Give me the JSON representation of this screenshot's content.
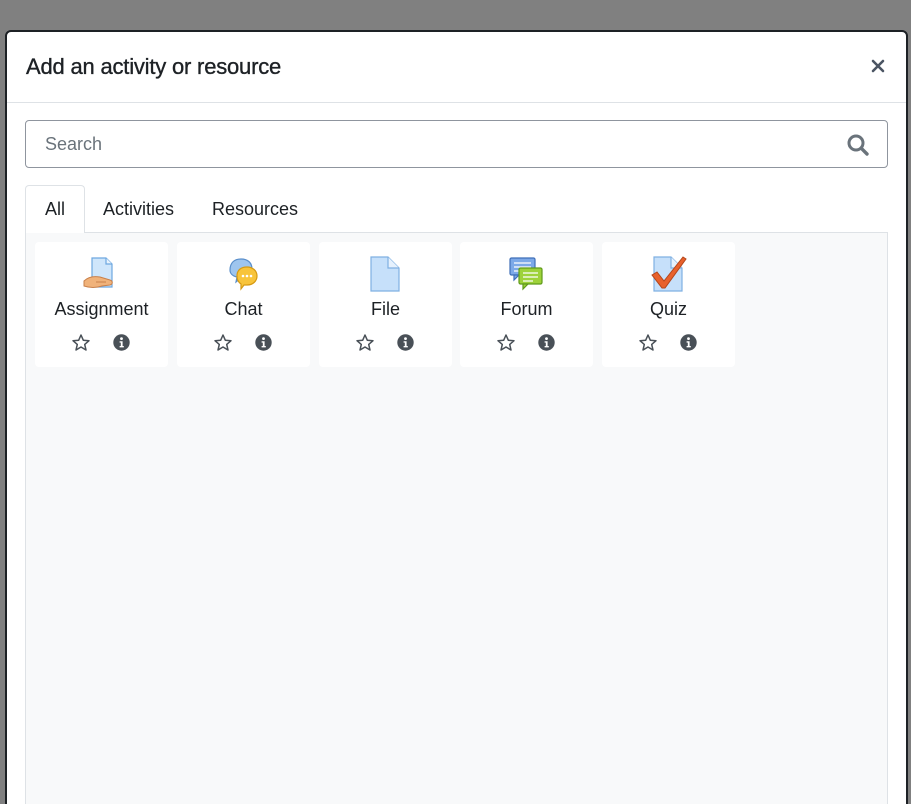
{
  "dialog": {
    "title": "Add an activity or resource",
    "close_label": "×"
  },
  "search": {
    "placeholder": "Search",
    "value": ""
  },
  "tabs": [
    {
      "label": "All",
      "active": true
    },
    {
      "label": "Activities",
      "active": false
    },
    {
      "label": "Resources",
      "active": false
    }
  ],
  "modules": [
    {
      "name": "Assignment",
      "icon": "assignment-icon",
      "starred": false
    },
    {
      "name": "Chat",
      "icon": "chat-icon",
      "starred": false
    },
    {
      "name": "File",
      "icon": "file-icon",
      "starred": false
    },
    {
      "name": "Forum",
      "icon": "forum-icon",
      "starred": false
    },
    {
      "name": "Quiz",
      "icon": "quiz-icon",
      "starred": false
    }
  ],
  "colors": {
    "backdrop": "#808080",
    "text": "#1d2125",
    "content_bg": "#f8f9fa",
    "border": "#dee2e6"
  }
}
